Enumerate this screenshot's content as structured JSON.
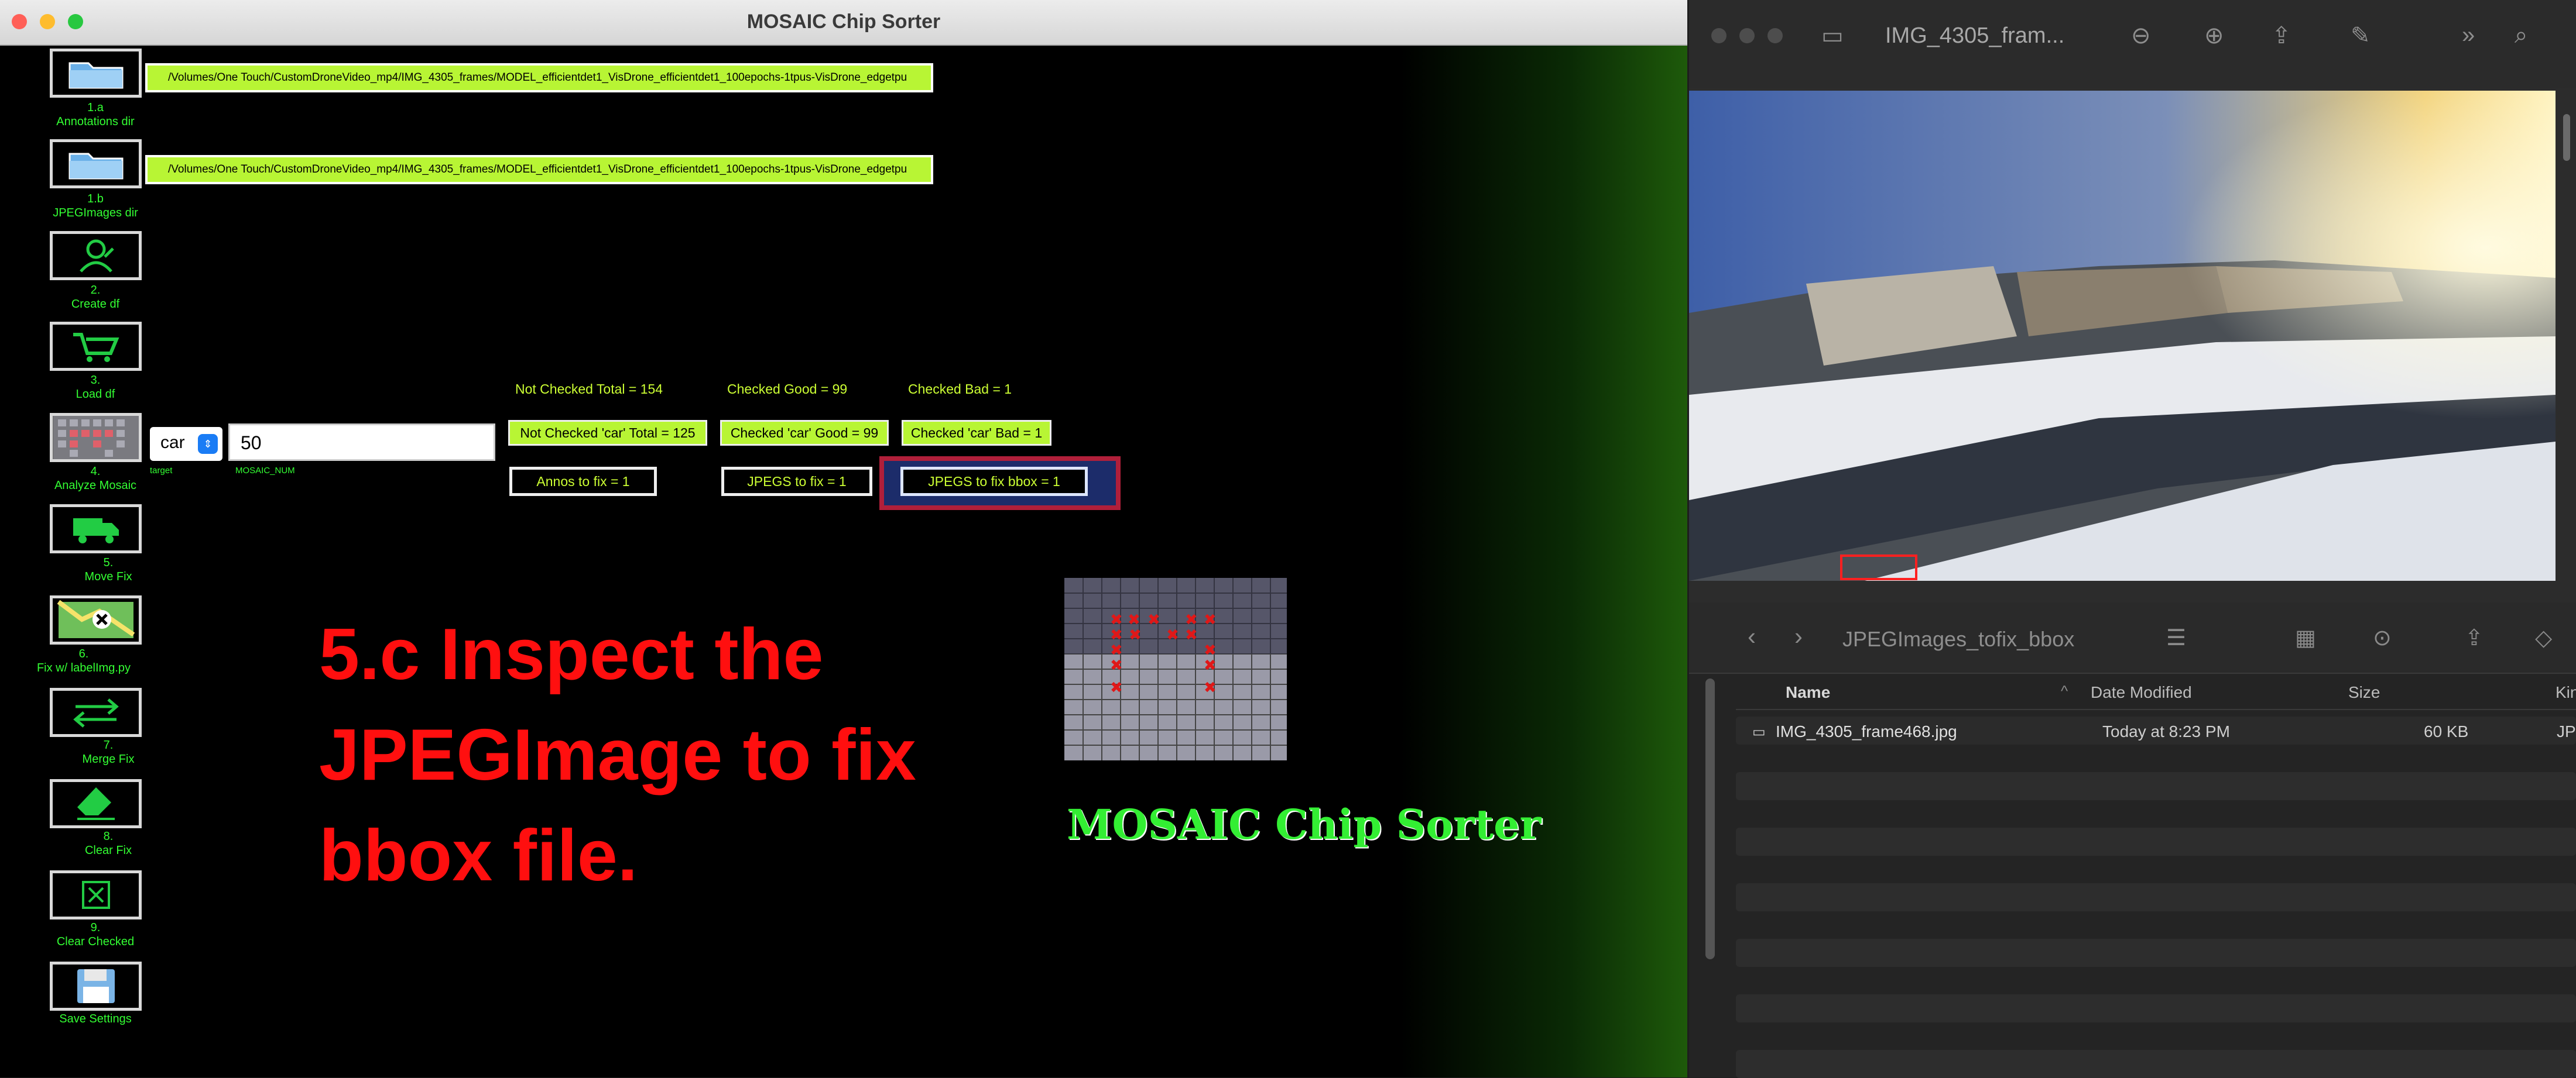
{
  "main_window": {
    "title": "MOSAIC Chip Sorter",
    "colors": {
      "close": "#ff5f57",
      "minimize": "#febc2e",
      "maximize": "#28c840",
      "accent": "#b8f534",
      "label": "#33ff33",
      "overlay": "#ff0f0f"
    },
    "sidebar": [
      {
        "icon": "folder-icon",
        "number": "1.a",
        "label": "Annotations dir"
      },
      {
        "icon": "folder-icon",
        "number": "1.b",
        "label": "JPEGImages dir"
      },
      {
        "icon": "create-df-icon",
        "number": "2.",
        "label": "Create df"
      },
      {
        "icon": "cart-icon",
        "number": "3.",
        "label": "Load df"
      },
      {
        "icon": "mosaic-icon",
        "number": "4.",
        "label": "Analyze Mosaic"
      },
      {
        "icon": "truck-icon",
        "number": "5.",
        "label": "Move Fix"
      },
      {
        "icon": "map-icon",
        "number": "6.",
        "label": "Fix w/ labelImg.py"
      },
      {
        "icon": "arrows-icon",
        "number": "7.",
        "label": "Merge Fix"
      },
      {
        "icon": "eraser-icon",
        "number": "8.",
        "label": "Clear Fix"
      },
      {
        "icon": "x-box-icon",
        "number": "9.",
        "label": "Clear Checked"
      },
      {
        "icon": "floppy-icon",
        "number": "",
        "label": "Save Settings"
      }
    ],
    "paths": {
      "annotations": "/Volumes/One Touch/CustomDroneVideo_mp4/IMG_4305_frames/MODEL_efficientdet1_VisDrone_efficientdet1_100epochs-1tpus-VisDrone_edgetpu",
      "jpegimages": "/Volumes/One Touch/CustomDroneVideo_mp4/IMG_4305_frames/MODEL_efficientdet1_VisDrone_efficientdet1_100epochs-1tpus-VisDrone_edgetpu"
    },
    "target": {
      "value": "car",
      "label": "target"
    },
    "mosaic_num": {
      "value": "50",
      "label": "MOSAIC_NUM"
    },
    "stats": {
      "not_checked_total": "Not Checked Total = 154",
      "checked_good": "Checked Good = 99",
      "checked_bad": "Checked Bad = 1",
      "not_checked_car": "Not Checked 'car' Total = 125",
      "checked_good_car": "Checked 'car' Good = 99",
      "checked_bad_car": "Checked 'car' Bad = 1",
      "annos_to_fix": "Annos to fix = 1",
      "jpegs_to_fix": "JPEGS to fix = 1",
      "jpegs_to_fix_bbox": "JPEGS to fix bbox = 1"
    },
    "overlay_lines": [
      "5.c  Inspect the",
      "JPEGImage to fix",
      "bbox file."
    ],
    "logo_text": "MOSAIC Chip Sorter"
  },
  "preview_window": {
    "title": "IMG_4305_fram..."
  },
  "finder_window": {
    "folder": "JPEGImages_tofix_bbox",
    "columns": {
      "name": "Name",
      "date": "Date Modified",
      "size": "Size",
      "kind": "Kin"
    },
    "files": [
      {
        "name": "IMG_4305_frame468.jpg",
        "date": "Today at 8:23 PM",
        "size": "60 KB",
        "kind": "JP"
      }
    ]
  }
}
